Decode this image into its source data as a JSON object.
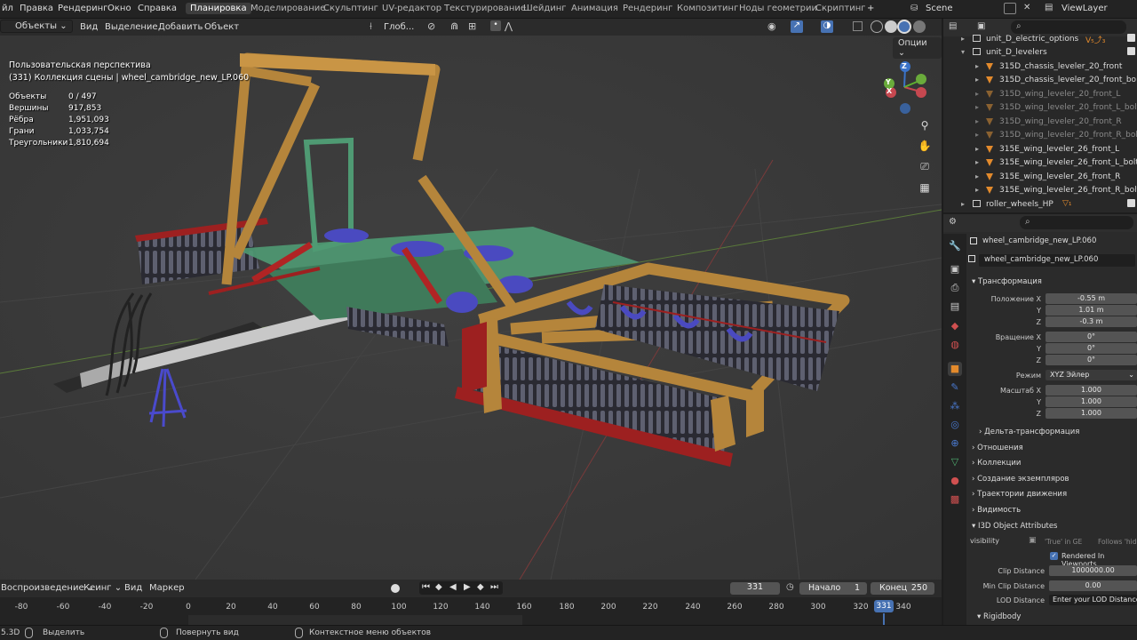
{
  "top_menu": {
    "file": "йл",
    "edit": "Правка",
    "render": "Рендеринг",
    "window": "Окно",
    "help": "Справка"
  },
  "workspaces": [
    "Планировка",
    "Моделирование",
    "Скульптинг",
    "UV-редактор",
    "Текстурирование",
    "Шейдинг",
    "Анимация",
    "Рендеринг",
    "Композитинг",
    "Ноды геометрии",
    "Скриптинг"
  ],
  "workspace_add": "+",
  "scene": "Scene",
  "view_layer": "ViewLayer",
  "viewport_header": {
    "mode": "Объекты",
    "view": "Вид",
    "select": "Выделение",
    "add": "Добавить",
    "object": "Объект",
    "orientation": "Глоб...",
    "options": "Опции"
  },
  "overlay": {
    "perspective": "Пользовательская перспектива",
    "collection": "(331) Коллекция сцены | wheel_cambridge_new_LP.060"
  },
  "stats": [
    {
      "label": "Объекты",
      "value": "0 / 497"
    },
    {
      "label": "Вершины",
      "value": "917,853"
    },
    {
      "label": "Рёбра",
      "value": "1,951,093"
    },
    {
      "label": "Грани",
      "value": "1,033,754"
    },
    {
      "label": "Треугольники",
      "value": "1,810,694"
    }
  ],
  "gizmo": {
    "z": "Z",
    "y": "Y",
    "x": "X"
  },
  "outliner": {
    "rows": [
      {
        "label": "unit_D_electric_options",
        "type": "collection",
        "extra": "V₅⤴₃",
        "dim": false
      },
      {
        "label": "unit_D_levelers",
        "type": "collection",
        "extra": "",
        "dim": false
      },
      {
        "label": "315D_chassis_leveler_20_front",
        "type": "mesh",
        "dim": false
      },
      {
        "label": "315D_chassis_leveler_20_front_bol",
        "type": "mesh",
        "dim": false
      },
      {
        "label": "315D_wing_leveler_20_front_L",
        "type": "mesh",
        "dim": true
      },
      {
        "label": "315D_wing_leveler_20_front_L_bolt",
        "type": "mesh",
        "dim": true
      },
      {
        "label": "315D_wing_leveler_20_front_R",
        "type": "mesh",
        "dim": true
      },
      {
        "label": "315D_wing_leveler_20_front_R_bol",
        "type": "mesh",
        "dim": true
      },
      {
        "label": "315E_wing_leveler_26_front_L",
        "type": "mesh",
        "dim": false
      },
      {
        "label": "315E_wing_leveler_26_front_L_bolt",
        "type": "mesh",
        "dim": false
      },
      {
        "label": "315E_wing_leveler_26_front_R",
        "type": "mesh",
        "dim": false
      },
      {
        "label": "315E_wing_leveler_26_front_R_bolt",
        "type": "mesh",
        "dim": false
      },
      {
        "label": "roller_wheels_HP",
        "type": "collection",
        "extra": "▽₁",
        "dim": false
      }
    ]
  },
  "properties": {
    "object_name": "wheel_cambridge_new_LP.060",
    "object_field": "wheel_cambridge_new_LP.060",
    "transform_title": "Трансформация",
    "loc_label": "Положение X",
    "loc": [
      "-0.55 m",
      "1.01 m",
      "-0.3 m"
    ],
    "rot_label": "Вращение X",
    "rot": [
      "0°",
      "0°",
      "0°"
    ],
    "mode_label": "Режим",
    "mode": "XYZ Эйлер",
    "scale_label": "Масштаб X",
    "scale": [
      "1.000",
      "1.000",
      "1.000"
    ],
    "axis_y": "Y",
    "axis_z": "Z",
    "delta": "Дельта-трансформация",
    "sections": [
      "Отношения",
      "Коллекции",
      "Создание экземпляров",
      "Траектории движения",
      "Видимость"
    ],
    "i3d_title": "I3D Object Attributes",
    "visibility_label": "visibility",
    "true_in_ge": "'True' in GE",
    "follows_hide": "Follows 'hide_",
    "rendered_label": "Rendered In Viewports",
    "clip_label": "Clip Distance",
    "clip_value": "1000000.00",
    "minclip_label": "Min Clip Distance",
    "minclip_value": "0.00",
    "lod_label": "LOD Distance",
    "lod_value": "Enter your LOD Distances if",
    "rigidbody": "Rigidbody"
  },
  "timeline": {
    "playback": "Воспроизведение",
    "keying": "Кеинг",
    "view": "Вид",
    "markers": "Маркер",
    "current_frame": "331",
    "start_label": "Начало",
    "start": "1",
    "end_label": "Конец",
    "end": "250",
    "ticks": [
      "-80",
      "-60",
      "-40",
      "-20",
      "0",
      "20",
      "40",
      "60",
      "80",
      "100",
      "120",
      "140",
      "160",
      "180",
      "200",
      "220",
      "240",
      "260",
      "280",
      "300",
      "320",
      "340"
    ],
    "cursor": "331"
  },
  "statusbar": {
    "version": "5.3D",
    "select": "Выделить",
    "rotate": "Повернуть вид",
    "context": "Контекстное меню объектов"
  },
  "colors": {
    "accent": "#4772b3",
    "active_tab": "#3d3d3d",
    "orange": "#e38a2c",
    "wood": "#b5853b",
    "green": "#4f9a73",
    "red": "#9d2020",
    "blue": "#4a4ac0"
  }
}
